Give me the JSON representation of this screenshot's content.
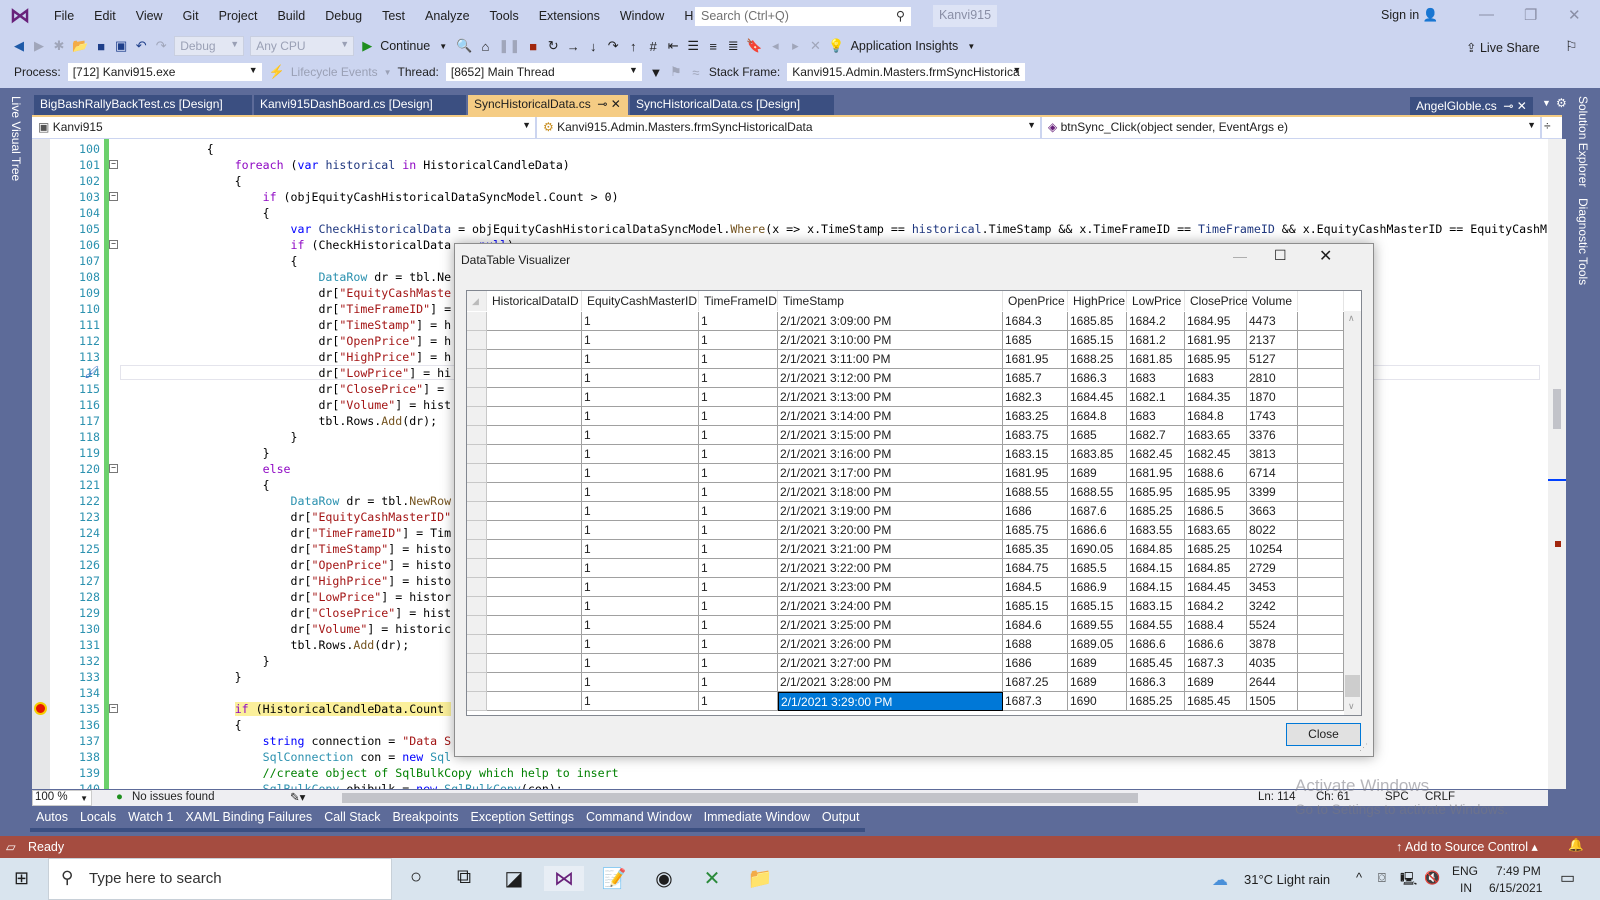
{
  "titlebar": {
    "menus": [
      "File",
      "Edit",
      "View",
      "Git",
      "Project",
      "Build",
      "Debug",
      "Test",
      "Analyze",
      "Tools",
      "Extensions",
      "Window",
      "Help"
    ],
    "search_placeholder": "Search (Ctrl+Q)",
    "solution_name": "Kanvi915",
    "sign_in": "Sign in"
  },
  "toolbar": {
    "config": "Debug",
    "platform": "Any CPU",
    "continue": "Continue",
    "app_insights": "Application Insights",
    "live_share": "Live Share"
  },
  "procbar": {
    "process_label": "Process:",
    "process": "[712] Kanvi915.exe",
    "lifecycle": "Lifecycle Events",
    "thread_label": "Thread:",
    "thread": "[8652] Main Thread",
    "stack_label": "Stack Frame:",
    "stack": "Kanvi915.Admin.Masters.frmSyncHistorica"
  },
  "tabs": [
    "BigBashRallyBackTest.cs [Design]",
    "Kanvi915DashBoard.cs [Design]",
    "SyncHistoricalData.cs",
    "SyncHistoricalData.cs [Design]"
  ],
  "active_tab": 2,
  "right_tab": "AngelGloble.cs",
  "navbar": {
    "project": "Kanvi915",
    "class": "Kanvi915.Admin.Masters.frmSyncHistoricalData",
    "member": "btnSync_Click(object sender, EventArgs e)"
  },
  "side_tools": {
    "left": "Live Visual Tree",
    "right1": "Solution Explorer",
    "right2": "Diagnostic Tools"
  },
  "editor": {
    "lines": [
      {
        "n": "100",
        "seg": [
          [
            "            {",
            ""
          ]
        ]
      },
      {
        "n": "101",
        "seg": [
          [
            "                ",
            ""
          ],
          [
            "foreach",
            "c"
          ],
          [
            " (",
            ""
          ],
          [
            "var",
            "k"
          ],
          [
            " historical ",
            "v"
          ],
          [
            "in",
            "c"
          ],
          [
            " HistoricalCandleData)",
            ""
          ]
        ]
      },
      {
        "n": "102",
        "seg": [
          [
            "                {",
            ""
          ]
        ]
      },
      {
        "n": "103",
        "seg": [
          [
            "                    ",
            ""
          ],
          [
            "if",
            "c"
          ],
          [
            " (objEquityCashHistoricalDataSyncModel.Count > 0)",
            ""
          ]
        ]
      },
      {
        "n": "104",
        "seg": [
          [
            "                    {",
            ""
          ]
        ]
      },
      {
        "n": "105",
        "seg": [
          [
            "                        ",
            ""
          ],
          [
            "var",
            "k"
          ],
          [
            " CheckHistoricalData ",
            "v"
          ],
          [
            "= objEquityCashHistoricalDataSyncModel.",
            ""
          ],
          [
            "Where",
            "m"
          ],
          [
            "(x => x.TimeStamp == ",
            ""
          ],
          [
            "historical",
            "v"
          ],
          [
            ".TimeStamp && x.TimeFrameID == ",
            ""
          ],
          [
            "TimeFrameID",
            "v"
          ],
          [
            " && x.EquityCashMasterID == EquityCashM",
            ""
          ]
        ]
      },
      {
        "n": "106",
        "seg": [
          [
            "                        ",
            ""
          ],
          [
            "if",
            "c"
          ],
          [
            " (CheckHistoricalData == ",
            ""
          ],
          [
            "null",
            "k"
          ],
          [
            ")",
            ""
          ]
        ]
      },
      {
        "n": "107",
        "seg": [
          [
            "                        {",
            ""
          ]
        ]
      },
      {
        "n": "108",
        "seg": [
          [
            "                            ",
            ""
          ],
          [
            "DataRow",
            "t"
          ],
          [
            " dr = tbl.Ne",
            ""
          ]
        ]
      },
      {
        "n": "109",
        "seg": [
          [
            "                            dr[",
            ""
          ],
          [
            "\"EquityCashMaste",
            "s"
          ]
        ]
      },
      {
        "n": "110",
        "seg": [
          [
            "                            dr[",
            ""
          ],
          [
            "\"TimeFrameID\"",
            "s"
          ],
          [
            "] =",
            ""
          ]
        ]
      },
      {
        "n": "111",
        "seg": [
          [
            "                            dr[",
            ""
          ],
          [
            "\"TimeStamp\"",
            "s"
          ],
          [
            "] = h",
            ""
          ]
        ]
      },
      {
        "n": "112",
        "seg": [
          [
            "                            dr[",
            ""
          ],
          [
            "\"OpenPrice\"",
            "s"
          ],
          [
            "] = h",
            ""
          ]
        ]
      },
      {
        "n": "113",
        "seg": [
          [
            "                            dr[",
            ""
          ],
          [
            "\"HighPrice\"",
            "s"
          ],
          [
            "] = h",
            ""
          ]
        ]
      },
      {
        "n": "114",
        "seg": [
          [
            "                            dr[",
            ""
          ],
          [
            "\"LowPrice\"",
            "s"
          ],
          [
            "] = hi",
            ""
          ]
        ]
      },
      {
        "n": "115",
        "seg": [
          [
            "                            dr[",
            ""
          ],
          [
            "\"ClosePrice\"",
            "s"
          ],
          [
            "] =",
            ""
          ]
        ]
      },
      {
        "n": "116",
        "seg": [
          [
            "                            dr[",
            ""
          ],
          [
            "\"Volume\"",
            "s"
          ],
          [
            "] = hist",
            ""
          ]
        ]
      },
      {
        "n": "117",
        "seg": [
          [
            "                            tbl.Rows.",
            ""
          ],
          [
            "Add",
            "m"
          ],
          [
            "(dr);",
            ""
          ]
        ]
      },
      {
        "n": "118",
        "seg": [
          [
            "                        }",
            ""
          ]
        ]
      },
      {
        "n": "119",
        "seg": [
          [
            "                    }",
            ""
          ]
        ]
      },
      {
        "n": "120",
        "seg": [
          [
            "                    ",
            ""
          ],
          [
            "else",
            "c"
          ]
        ]
      },
      {
        "n": "121",
        "seg": [
          [
            "                    {",
            ""
          ]
        ]
      },
      {
        "n": "122",
        "seg": [
          [
            "                        ",
            ""
          ],
          [
            "DataRow",
            "t"
          ],
          [
            " dr = tbl.",
            ""
          ],
          [
            "NewRow",
            "m"
          ]
        ]
      },
      {
        "n": "123",
        "seg": [
          [
            "                        dr[",
            ""
          ],
          [
            "\"EquityCashMasterID\"",
            "s"
          ]
        ]
      },
      {
        "n": "124",
        "seg": [
          [
            "                        dr[",
            ""
          ],
          [
            "\"TimeFrameID\"",
            "s"
          ],
          [
            "] = Tim",
            ""
          ]
        ]
      },
      {
        "n": "125",
        "seg": [
          [
            "                        dr[",
            ""
          ],
          [
            "\"TimeStamp\"",
            "s"
          ],
          [
            "] = histo",
            ""
          ]
        ]
      },
      {
        "n": "126",
        "seg": [
          [
            "                        dr[",
            ""
          ],
          [
            "\"OpenPrice\"",
            "s"
          ],
          [
            "] = histo",
            ""
          ]
        ]
      },
      {
        "n": "127",
        "seg": [
          [
            "                        dr[",
            ""
          ],
          [
            "\"HighPrice\"",
            "s"
          ],
          [
            "] = histo",
            ""
          ]
        ]
      },
      {
        "n": "128",
        "seg": [
          [
            "                        dr[",
            ""
          ],
          [
            "\"LowPrice\"",
            "s"
          ],
          [
            "] = histor",
            ""
          ]
        ]
      },
      {
        "n": "129",
        "seg": [
          [
            "                        dr[",
            ""
          ],
          [
            "\"ClosePrice\"",
            "s"
          ],
          [
            "] = hist",
            ""
          ]
        ]
      },
      {
        "n": "130",
        "seg": [
          [
            "                        dr[",
            ""
          ],
          [
            "\"Volume\"",
            "s"
          ],
          [
            "] = historic",
            ""
          ]
        ]
      },
      {
        "n": "131",
        "seg": [
          [
            "                        tbl.Rows.",
            ""
          ],
          [
            "Add",
            "m"
          ],
          [
            "(dr);",
            ""
          ]
        ]
      },
      {
        "n": "132",
        "seg": [
          [
            "                    }",
            ""
          ]
        ]
      },
      {
        "n": "133",
        "seg": [
          [
            "                }",
            ""
          ]
        ]
      },
      {
        "n": "134",
        "seg": [
          [
            "",
            ""
          ]
        ]
      },
      {
        "n": "135",
        "seg": [
          [
            "                ",
            ""
          ],
          [
            "if",
            "hlc"
          ],
          [
            " (HistoricalCandleData.Count ",
            "hl"
          ]
        ]
      },
      {
        "n": "136",
        "seg": [
          [
            "                {",
            ""
          ]
        ]
      },
      {
        "n": "137",
        "seg": [
          [
            "                    ",
            ""
          ],
          [
            "string",
            "k"
          ],
          [
            " connection = ",
            ""
          ],
          [
            "\"Data S",
            "s"
          ]
        ]
      },
      {
        "n": "138",
        "seg": [
          [
            "                    ",
            ""
          ],
          [
            "SqlConnection",
            "t"
          ],
          [
            " con = ",
            ""
          ],
          [
            "new",
            "k"
          ],
          [
            " ",
            ""
          ],
          [
            "Sql",
            "t"
          ]
        ]
      },
      {
        "n": "139",
        "seg": [
          [
            "                    ",
            ""
          ],
          [
            "//create object of SqlBulkCopy which help to insert",
            "g"
          ]
        ]
      },
      {
        "n": "140",
        "seg": [
          [
            "                    ",
            ""
          ],
          [
            "SqlBulkCopy",
            "t"
          ],
          [
            " objbulk = ",
            ""
          ],
          [
            "new",
            "k"
          ],
          [
            " ",
            ""
          ],
          [
            "SqlBulkCopy",
            "t"
          ],
          [
            "(con);",
            ""
          ]
        ]
      }
    ],
    "breakpoint_line": "135",
    "current_line": "114"
  },
  "statusrow": {
    "zoom": "100 %",
    "issues": "No issues found",
    "ln": "Ln: 114",
    "ch": "Ch: 61",
    "spc": "SPC",
    "crlf": "CRLF"
  },
  "bottom_tabs": [
    "Autos",
    "Locals",
    "Watch 1",
    "XAML Binding Failures",
    "Call Stack",
    "Breakpoints",
    "Exception Settings",
    "Command Window",
    "Immediate Window",
    "Output"
  ],
  "statusbar": {
    "ready": "Ready",
    "source_control": "Add to Source Control"
  },
  "watermark": {
    "line1": "Activate Windows",
    "line2": "Go to Settings to activate Windows."
  },
  "taskbar": {
    "search_placeholder": "Type here to search",
    "weather": "31°C  Light rain",
    "lang1": "ENG",
    "lang2": "IN",
    "time": "7:49 PM",
    "date": "6/15/2021"
  },
  "dialog": {
    "title": "DataTable Visualizer",
    "close_button": "Close",
    "columns": [
      "HistoricalDataID",
      "EquityCashMasterID",
      "TimeFrameID",
      "TimeStamp",
      "OpenPrice",
      "HighPrice",
      "LowPrice",
      "ClosePrice",
      "Volume"
    ],
    "rows": [
      [
        "",
        "1",
        "1",
        "2/1/2021 3:09:00 PM",
        "1684.3",
        "1685.85",
        "1684.2",
        "1684.95",
        "4473"
      ],
      [
        "",
        "1",
        "1",
        "2/1/2021 3:10:00 PM",
        "1685",
        "1685.15",
        "1681.2",
        "1681.95",
        "2137"
      ],
      [
        "",
        "1",
        "1",
        "2/1/2021 3:11:00 PM",
        "1681.95",
        "1688.25",
        "1681.85",
        "1685.95",
        "5127"
      ],
      [
        "",
        "1",
        "1",
        "2/1/2021 3:12:00 PM",
        "1685.7",
        "1686.3",
        "1683",
        "1683",
        "2810"
      ],
      [
        "",
        "1",
        "1",
        "2/1/2021 3:13:00 PM",
        "1682.3",
        "1684.45",
        "1682.1",
        "1684.35",
        "1870"
      ],
      [
        "",
        "1",
        "1",
        "2/1/2021 3:14:00 PM",
        "1683.25",
        "1684.8",
        "1683",
        "1684.8",
        "1743"
      ],
      [
        "",
        "1",
        "1",
        "2/1/2021 3:15:00 PM",
        "1683.75",
        "1685",
        "1682.7",
        "1683.65",
        "3376"
      ],
      [
        "",
        "1",
        "1",
        "2/1/2021 3:16:00 PM",
        "1683.15",
        "1683.85",
        "1682.45",
        "1682.45",
        "3813"
      ],
      [
        "",
        "1",
        "1",
        "2/1/2021 3:17:00 PM",
        "1681.95",
        "1689",
        "1681.95",
        "1688.6",
        "6714"
      ],
      [
        "",
        "1",
        "1",
        "2/1/2021 3:18:00 PM",
        "1688.55",
        "1688.55",
        "1685.95",
        "1685.95",
        "3399"
      ],
      [
        "",
        "1",
        "1",
        "2/1/2021 3:19:00 PM",
        "1686",
        "1687.6",
        "1685.25",
        "1686.5",
        "3663"
      ],
      [
        "",
        "1",
        "1",
        "2/1/2021 3:20:00 PM",
        "1685.75",
        "1686.6",
        "1683.55",
        "1683.65",
        "8022"
      ],
      [
        "",
        "1",
        "1",
        "2/1/2021 3:21:00 PM",
        "1685.35",
        "1690.05",
        "1684.85",
        "1685.25",
        "10254"
      ],
      [
        "",
        "1",
        "1",
        "2/1/2021 3:22:00 PM",
        "1684.75",
        "1685.5",
        "1684.15",
        "1684.85",
        "2729"
      ],
      [
        "",
        "1",
        "1",
        "2/1/2021 3:23:00 PM",
        "1684.5",
        "1686.9",
        "1684.15",
        "1684.45",
        "3453"
      ],
      [
        "",
        "1",
        "1",
        "2/1/2021 3:24:00 PM",
        "1685.15",
        "1685.15",
        "1683.15",
        "1684.2",
        "3242"
      ],
      [
        "",
        "1",
        "1",
        "2/1/2021 3:25:00 PM",
        "1684.6",
        "1689.55",
        "1684.55",
        "1688.4",
        "5524"
      ],
      [
        "",
        "1",
        "1",
        "2/1/2021 3:26:00 PM",
        "1688",
        "1689.05",
        "1686.6",
        "1686.6",
        "3878"
      ],
      [
        "",
        "1",
        "1",
        "2/1/2021 3:27:00 PM",
        "1686",
        "1689",
        "1685.45",
        "1687.3",
        "4035"
      ],
      [
        "",
        "1",
        "1",
        "2/1/2021 3:28:00 PM",
        "1687.25",
        "1689",
        "1686.3",
        "1689",
        "2644"
      ],
      [
        "",
        "1",
        "1",
        "2/1/2021 3:29:00 PM",
        "1687.3",
        "1690",
        "1685.25",
        "1685.45",
        "1505"
      ]
    ],
    "selected_cell": {
      "row": 20,
      "col": 3
    }
  },
  "colors": {
    "accent": "#5d6b99",
    "active_tab": "#f5cc84",
    "statusbar": "#a54c40",
    "selection": "#0078d7"
  }
}
